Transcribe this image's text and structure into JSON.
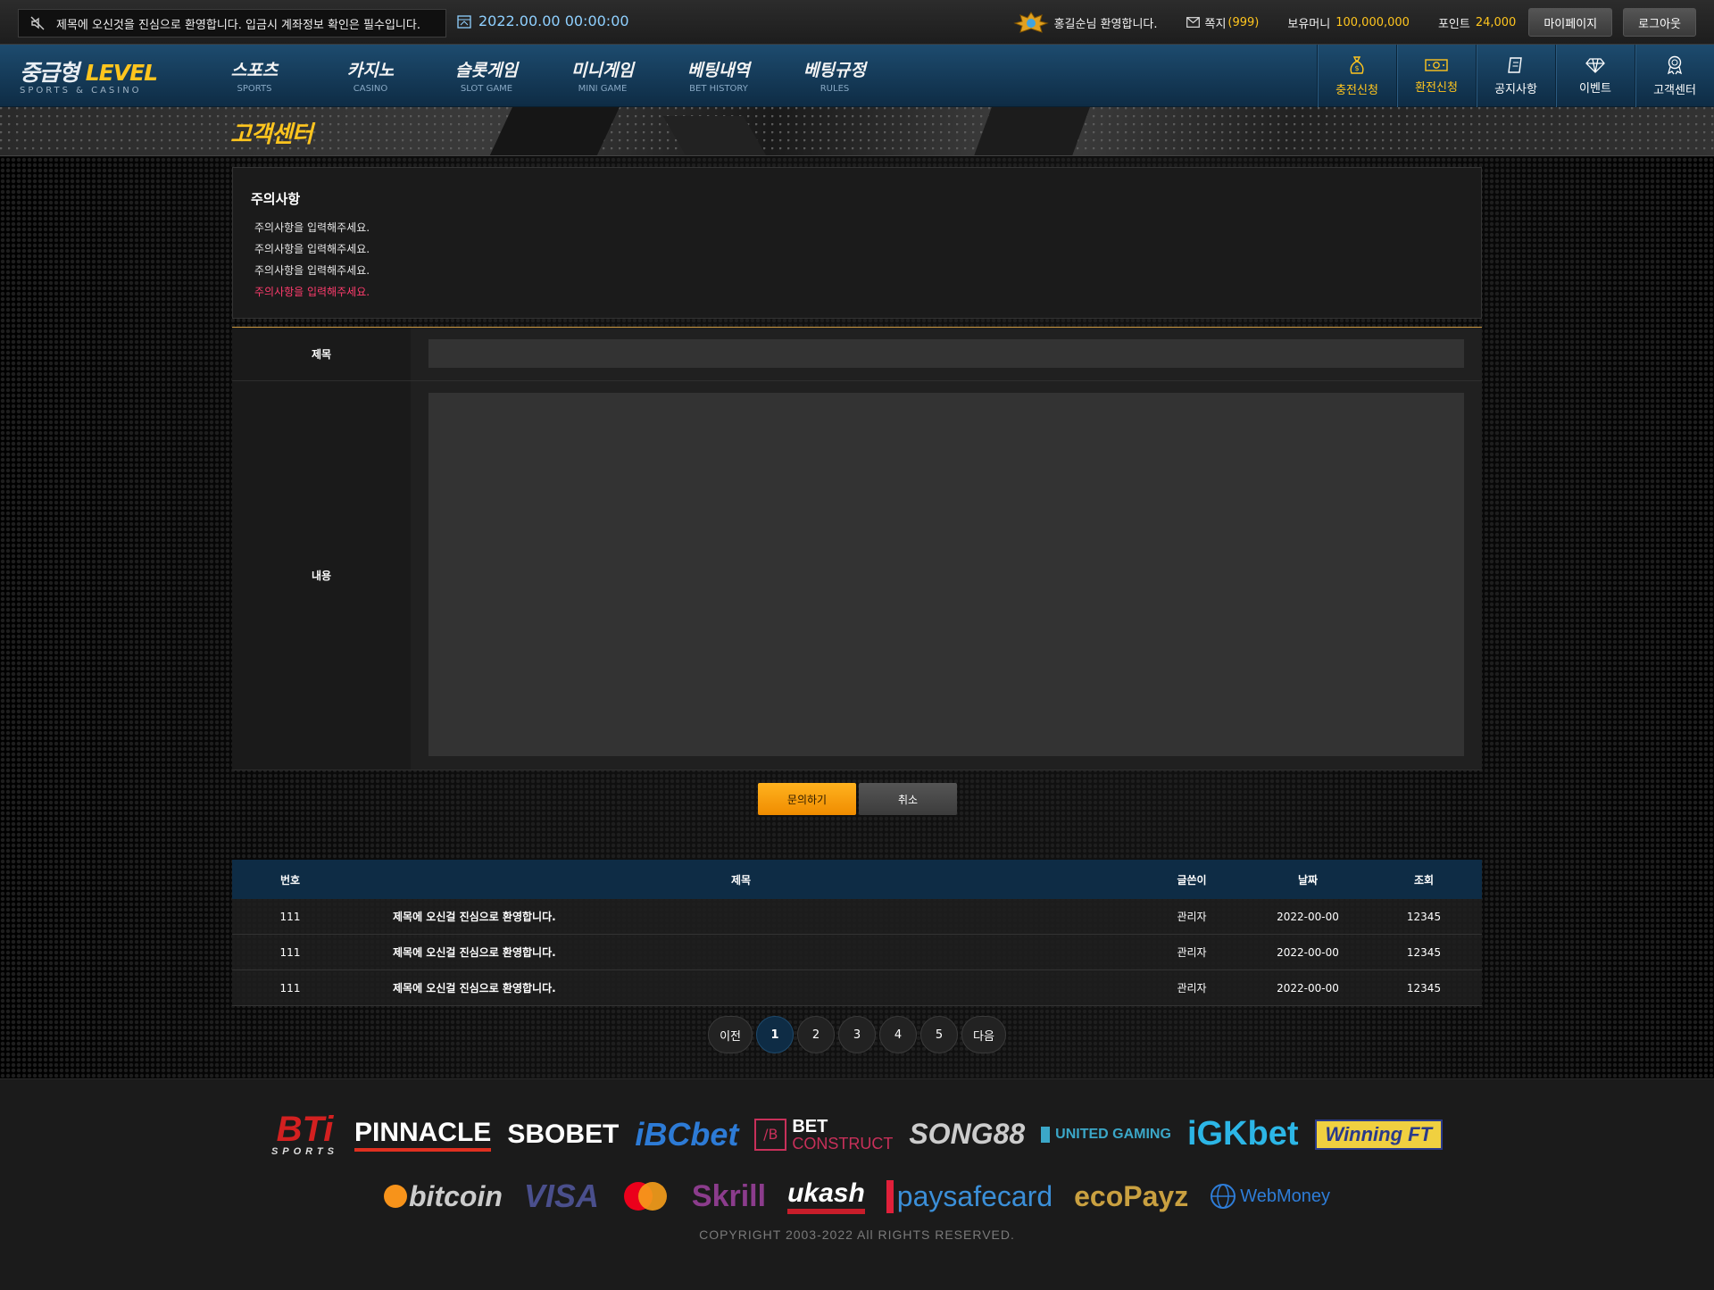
{
  "topbar": {
    "notice": "제목에 오신것을 진심으로 환영합니다. 입금시 계좌정보 확인은 필수입니다.",
    "datetime": "2022.00.00  00:00:00",
    "welcome": "홍길순님 환영합니다.",
    "message_label": "쪽지",
    "message_count": "(999)",
    "money_label": "보유머니",
    "money_value": "100,000,000",
    "point_label": "포인트",
    "point_value": "24,000",
    "mypage_label": "마이페이지",
    "logout_label": "로그아웃"
  },
  "nav": {
    "logo_main": "중급형",
    "logo_level": "LEVEL",
    "logo_sub": "SPORTS & CASINO",
    "menu": [
      {
        "ko": "스포츠",
        "en": "SPORTS"
      },
      {
        "ko": "카지노",
        "en": "CASINO"
      },
      {
        "ko": "슬롯게임",
        "en": "SLOT GAME"
      },
      {
        "ko": "미니게임",
        "en": "MINI GAME"
      },
      {
        "ko": "베팅내역",
        "en": "BET HISTORY"
      },
      {
        "ko": "베팅규정",
        "en": "RULES"
      }
    ],
    "quick": [
      {
        "label": "충전신청",
        "icon": "moneybag-icon"
      },
      {
        "label": "환전신청",
        "icon": "banknote-icon"
      },
      {
        "label": "공지사항",
        "icon": "notebook-icon"
      },
      {
        "label": "이벤트",
        "icon": "diamond-icon"
      },
      {
        "label": "고객센터",
        "icon": "medal-icon"
      }
    ]
  },
  "banner": {
    "title": "고객센터"
  },
  "notice_box": {
    "title": "주의사항",
    "lines": [
      "주의사항을 입력해주세요.",
      "주의사항을 입력해주세요.",
      "주의사항을 입력해주세요.",
      "주의사항을 입력해주세요."
    ]
  },
  "form": {
    "subject_label": "제목",
    "content_label": "내용",
    "submit_label": "문의하기",
    "cancel_label": "취소"
  },
  "table": {
    "headers": {
      "no": "번호",
      "title": "제목",
      "writer": "글쓴이",
      "date": "날짜",
      "views": "조회"
    },
    "rows": [
      {
        "no": "111",
        "title": "제목에 오신걸 진심으로 환영합니다.",
        "writer": "관리자",
        "date": "2022-00-00",
        "views": "12345"
      },
      {
        "no": "111",
        "title": "제목에 오신걸 진심으로 환영합니다.",
        "writer": "관리자",
        "date": "2022-00-00",
        "views": "12345"
      },
      {
        "no": "111",
        "title": "제목에 오신걸 진심으로 환영합니다.",
        "writer": "관리자",
        "date": "2022-00-00",
        "views": "12345"
      }
    ]
  },
  "pagination": {
    "prev": "이전",
    "pages": [
      "1",
      "2",
      "3",
      "4",
      "5"
    ],
    "next": "다음",
    "current": "1"
  },
  "footer": {
    "providers": [
      "BTi",
      "SPORTS",
      "PINNACLE",
      "SBOBET",
      "iBCbet",
      "BET",
      "CONSTRUCT",
      "SONG88",
      "UNITED GAMING",
      "iGKbet",
      "Winning FT"
    ],
    "payments": [
      "bitcoin",
      "VISA",
      "Skrill",
      "ukash",
      "paysafecard",
      "ecoPayz",
      "WebMoney"
    ],
    "copyright": "COPYRIGHT 2003-2022 All RIGHTS RESERVED."
  },
  "colors": {
    "accent_yellow": "#ffc51e",
    "nav_blue": "#0e2c45",
    "highlight_red": "#ff3c6d",
    "button_orange": "#f08c00"
  }
}
